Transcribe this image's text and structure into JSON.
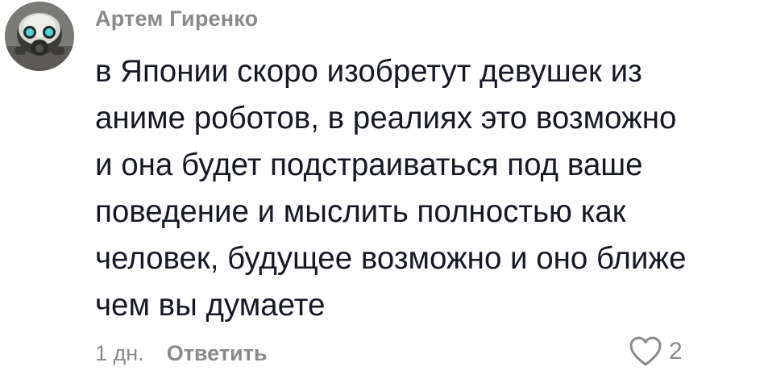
{
  "comment": {
    "username": "Артем Гиренко",
    "text_lines": [
      "в Японии скоро изобретут девушек из",
      "аниме роботов, в реалиях это возможно",
      "и она будет подстраиваться под ваше",
      "поведение и мыслить полностью как",
      "человек, будущее возможно и оно ближе",
      "чем вы думаете"
    ],
    "timestamp": "1 дн.",
    "reply_label": "Ответить",
    "like_count": "2",
    "icons": {
      "avatar": "gas-mask-avatar",
      "like": "heart-outline-icon"
    },
    "colors": {
      "text": "#161823",
      "secondary": "#8a8a8a",
      "avatar_eyes": "#4fd6d0"
    }
  }
}
